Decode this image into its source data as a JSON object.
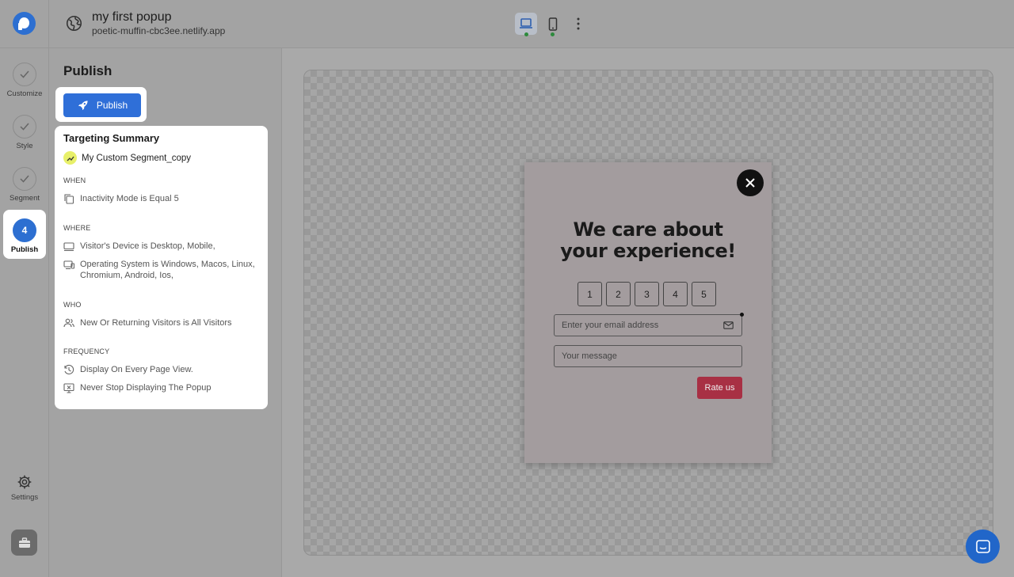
{
  "header": {
    "title": "my first popup",
    "subtitle": "poetic-muffin-cbc3ee.netlify.app"
  },
  "rail": {
    "items": [
      {
        "label": "Customize"
      },
      {
        "label": "Style"
      },
      {
        "label": "Segment"
      },
      {
        "label": "Publish",
        "step": "4"
      }
    ],
    "settings_label": "Settings"
  },
  "panel": {
    "title": "Publish",
    "publish_button": "Publish",
    "summary": {
      "title": "Targeting Summary",
      "segment": "My Custom Segment_copy",
      "when_head": "WHEN",
      "when": [
        "Inactivity Mode is Equal 5"
      ],
      "where_head": "WHERE",
      "where": [
        "Visitor's Device is Desktop, Mobile,",
        "Operating System is Windows, Macos, Linux, Chromium, Android, Ios,"
      ],
      "who_head": "WHO",
      "who": [
        "New Or Returning Visitors is All Visitors"
      ],
      "frequency_head": "FREQUENCY",
      "frequency": [
        "Display On Every Page View.",
        "Never Stop Displaying The Popup"
      ]
    }
  },
  "popup": {
    "title_line1": "We care about",
    "title_line2": "your experience!",
    "ratings": [
      "1",
      "2",
      "3",
      "4",
      "5"
    ],
    "email_placeholder": "Enter your email address",
    "message_placeholder": "Your message",
    "submit": "Rate us"
  },
  "colors": {
    "accent": "#2f6fd8",
    "submit": "#a83044",
    "status_dot": "#2d8a3c"
  }
}
